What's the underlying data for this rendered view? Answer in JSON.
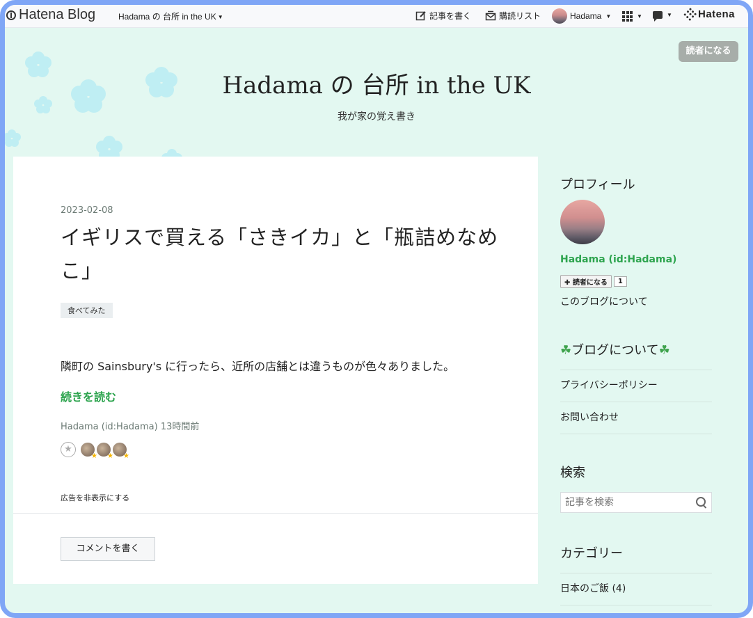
{
  "global_bar": {
    "logo": "Hatena Blog",
    "blog_name": "Hadama の 台所 in the UK",
    "write_label": "記事を書く",
    "reading_list_label": "購読リスト",
    "user_name": "Hadama",
    "hatena_label": "Hatena"
  },
  "header": {
    "title": "Hadama の 台所 in the UK",
    "description": "我が家の覚え書き",
    "subscribe_label": "読者になる"
  },
  "entry": {
    "date": "2023-02-08",
    "title": "イギリスで買える「さきイカ」と「瓶詰めなめこ」",
    "category": "食べてみた",
    "body": "隣町の Sainsbury's に行ったら、近所の店舗とは違うものが色々ありました。",
    "read_more": "続きを読む",
    "author": "Hadama (id:Hadama)",
    "time_ago": "13時間前",
    "star_count": 3,
    "hide_ads": "広告を非表示にする",
    "comment_button": "コメントを書く"
  },
  "sidebar": {
    "profile_heading": "プロフィール",
    "profile_name": "Hadama (id:Hadama)",
    "subscribe_small": "読者になる",
    "subscriber_count": "1",
    "about_link": "このブログについて",
    "about_heading": "ブログについて",
    "about_heading_icon": "clover-icon",
    "about_links": [
      "プライバシーポリシー",
      "お問い合わせ"
    ],
    "search_heading": "検索",
    "search_placeholder": "記事を検索",
    "category_heading": "カテゴリー",
    "categories": [
      "日本のご飯 (4)"
    ]
  },
  "colors": {
    "accent_green": "#2da44e",
    "header_bg": "#e3f8f1",
    "frame_border": "#7fa6f6"
  }
}
